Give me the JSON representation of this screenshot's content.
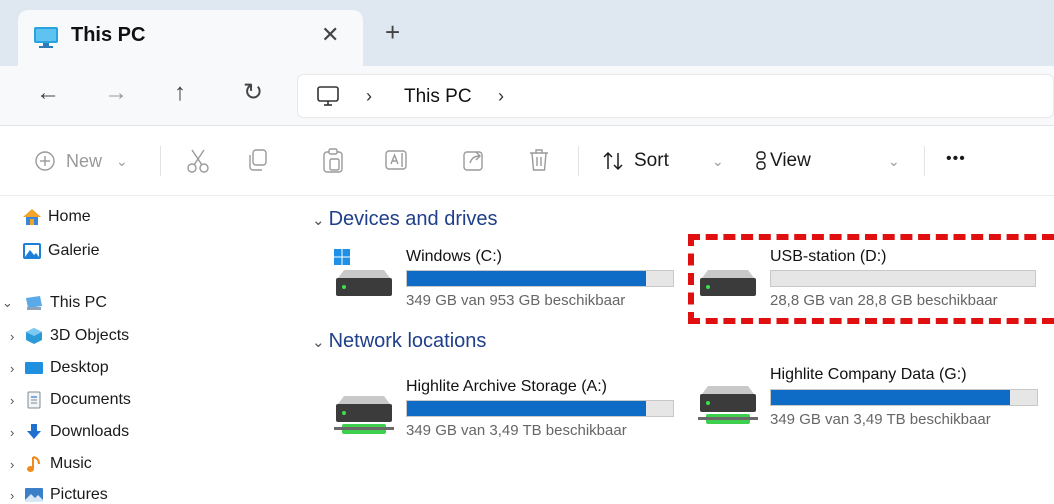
{
  "tab": {
    "title": "This PC",
    "close": "✕",
    "add": "+"
  },
  "nav": {
    "back": "←",
    "forward": "→",
    "up": "↑",
    "refresh": "↻"
  },
  "address": {
    "sep1": "›",
    "location": "This PC",
    "sep2": "›"
  },
  "toolbar": {
    "new_label": "New",
    "new_chevron": "⌄",
    "sort_label": "Sort",
    "sort_chevron": "⌄",
    "view_label": "View",
    "view_chevron": "⌄",
    "more_label": "•••"
  },
  "sidebar": {
    "home": "Home",
    "gallery": "Galerie",
    "this_pc": "This PC",
    "items": [
      "3D Objects",
      "Desktop",
      "Documents",
      "Downloads",
      "Music",
      "Pictures"
    ]
  },
  "sections": {
    "devices": "Devices and drives",
    "network": "Network locations"
  },
  "drives": [
    {
      "name": "Windows (C:)",
      "free": "349 GB van 953 GB beschikbaar",
      "used_fraction": 0.9
    },
    {
      "name": "USB-station (D:)",
      "free": "28,8 GB van 28,8 GB beschikbaar",
      "used_fraction": 0.0
    }
  ],
  "network": [
    {
      "name": "Highlite Archive Storage (A:)",
      "free": "349 GB van 3,49 TB beschikbaar",
      "used_fraction": 0.9
    },
    {
      "name": "Highlite Company Data (G:)",
      "free": "349 GB van 3,49 TB beschikbaar",
      "used_fraction": 0.9
    }
  ],
  "colors": {
    "accent": "#0f6cc6",
    "highlight": "#e01010",
    "section": "#1f3f8a"
  }
}
